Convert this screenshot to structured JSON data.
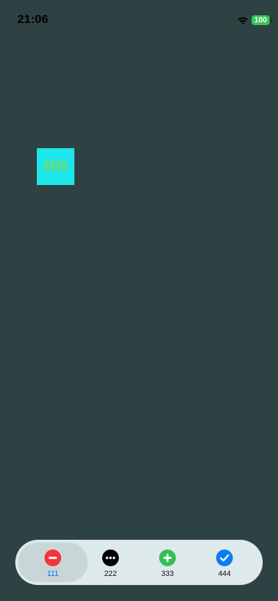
{
  "status_bar": {
    "time": "21:06",
    "battery_level": "100",
    "battery_color": "#34c759",
    "signal_icon": "cellular-dots-icon",
    "wifi_icon": "wifi-icon"
  },
  "main": {
    "jump_button_label": "跳转",
    "jump_button_bg": "#1de7e9",
    "jump_button_text_color": "#9bd33a",
    "background_color": "#2e4243"
  },
  "tab_bar": {
    "active_index": 0,
    "active_label_color": "#0a72e6",
    "tabs": [
      {
        "label": "111",
        "icon": "minus-circle-icon",
        "icon_color": "#f2353b"
      },
      {
        "label": "222",
        "icon": "ellipsis-circle-icon",
        "icon_color": "#000000"
      },
      {
        "label": "333",
        "icon": "plus-circle-icon",
        "icon_color": "#33bf55"
      },
      {
        "label": "444",
        "icon": "checkmark-circle-icon",
        "icon_color": "#0a7cf0"
      }
    ]
  }
}
